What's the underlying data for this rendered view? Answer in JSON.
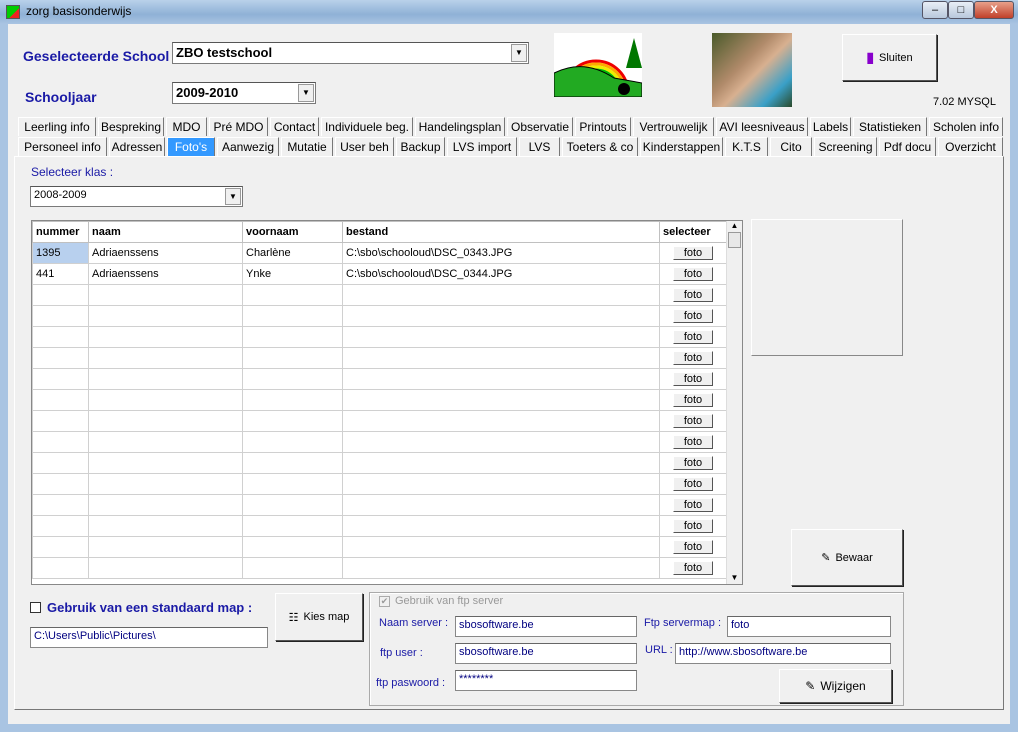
{
  "window": {
    "title": "zorg basisonderwijs",
    "min": "–",
    "max": "□",
    "close": "X"
  },
  "header": {
    "school_label": "Geselecteerde School :",
    "school_value": "ZBO testschool",
    "year_label": "Schooljaar",
    "year_value": "2009-2010",
    "close_button": "Sluiten",
    "version": "7.02 MYSQL"
  },
  "tabs_row1": [
    "Leerling info",
    "Bespreking",
    "MDO",
    "Pré MDO",
    "Contact",
    "Individuele beg.",
    "Handelingsplan",
    "Observatie",
    "Printouts",
    "Vertrouwelijk",
    "AVI leesniveaus",
    "Labels",
    "Statistieken",
    "Scholen info"
  ],
  "tabs_row2": [
    "Personeel info",
    "Adressen",
    "Foto's",
    "Aanwezig",
    "Mutatie",
    "User beh",
    "Backup",
    "LVS import",
    "LVS",
    "Toeters & co",
    "Kinderstappen",
    "K.T.S",
    "Cito",
    "Screening",
    "Pdf docu",
    "Overzicht"
  ],
  "active_tab": "Foto's",
  "klas": {
    "label": "Selecteer klas :",
    "value": "2008-2009"
  },
  "table": {
    "columns": [
      "nummer",
      "naam",
      "voornaam",
      "bestand",
      "selecteer"
    ],
    "button_label": "foto",
    "rows": [
      [
        "1395",
        "Adriaenssens",
        "Charlène",
        "C:\\sbo\\schooloud\\DSC_0343.JPG"
      ],
      [
        "441",
        "Adriaenssens",
        "Ynke",
        "C:\\sbo\\schooloud\\DSC_0344.JPG"
      ]
    ]
  },
  "bewaar_button": "Bewaar",
  "standard_map": {
    "label": "Gebruik van een standaard map :",
    "checked": false,
    "path": "C:\\Users\\Public\\Pictures\\",
    "button": "Kies map"
  },
  "ftp": {
    "checkbox_label": "Gebruik van ftp server",
    "checked": true,
    "server_label": "Naam server :",
    "server": "sbosoftware.be",
    "user_label": "ftp user :",
    "user": "sbosoftware.be",
    "password_label": "ftp paswoord :",
    "password": "********",
    "map_label": "Ftp servermap :",
    "map": "foto",
    "url_label": "URL :",
    "url": "http://www.sbosoftware.be",
    "button": "Wijzigen"
  },
  "colors": {
    "accent": "#3399ff",
    "label_blue": "#1a1aa6"
  }
}
